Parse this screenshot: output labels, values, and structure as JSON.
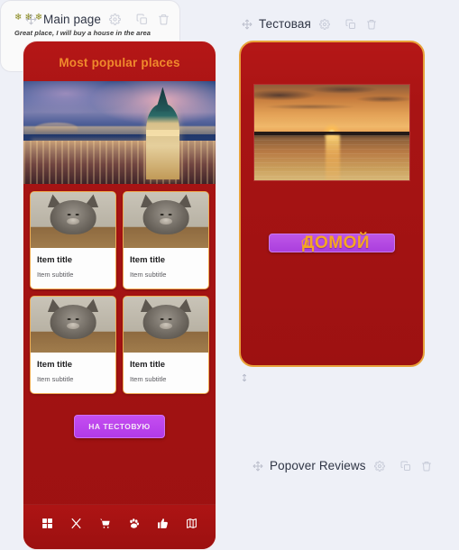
{
  "panels": [
    {
      "id": "main-page",
      "title": "Main page",
      "icons": [
        "move-icon",
        "gear-icon",
        "copy-icon",
        "trash-icon"
      ],
      "screen": {
        "header_title": "Most popular places",
        "hero_image": "istanbul-cityscape-photo",
        "cards": [
          {
            "image": "kitten-photo",
            "title": "Item title",
            "subtitle": "Item subtitle"
          },
          {
            "image": "kitten-photo",
            "title": "Item title",
            "subtitle": "Item subtitle"
          },
          {
            "image": "kitten-photo",
            "title": "Item title",
            "subtitle": "Item subtitle"
          },
          {
            "image": "kitten-photo",
            "title": "Item title",
            "subtitle": "Item subtitle"
          }
        ],
        "cta_button": "НА ТЕСТОВУЮ",
        "nav_items": [
          {
            "icon": "grid-icon",
            "label": ""
          },
          {
            "icon": "cutlery-icon",
            "label": ""
          },
          {
            "icon": "cart-icon",
            "label": ""
          },
          {
            "icon": "paw-icon",
            "label": ""
          },
          {
            "icon": "thumbs-up-icon",
            "label": ""
          },
          {
            "icon": "map-icon",
            "label": ""
          }
        ]
      }
    },
    {
      "id": "testovaya",
      "title": "Тестовая",
      "icons": [
        "move-icon",
        "gear-icon",
        "copy-icon",
        "trash-icon"
      ],
      "screen": {
        "image": "sunset-over-water-photo",
        "home_button": {
          "icon": "home-icon",
          "label": "ДОМОЙ"
        }
      }
    },
    {
      "id": "popover-reviews",
      "title": "Popover Reviews",
      "icons": [
        "move-icon",
        "gear-icon",
        "copy-icon",
        "trash-icon"
      ],
      "screen": {
        "stars": [
          "star-icon",
          "star-icon",
          "star-icon"
        ],
        "review_text": "Great place, I will buy a house in the area"
      }
    }
  ],
  "resize_handle": "vertical-resize-handle",
  "colors": {
    "canvas_bg": "#eef0f7",
    "phone_red": "#a61212",
    "accent_orange": "#f08a2c",
    "border_orange": "#e8a23a",
    "purple_button": "#b23ae8",
    "star_olive": "#8a8a20",
    "header_text": "#2f3545"
  }
}
